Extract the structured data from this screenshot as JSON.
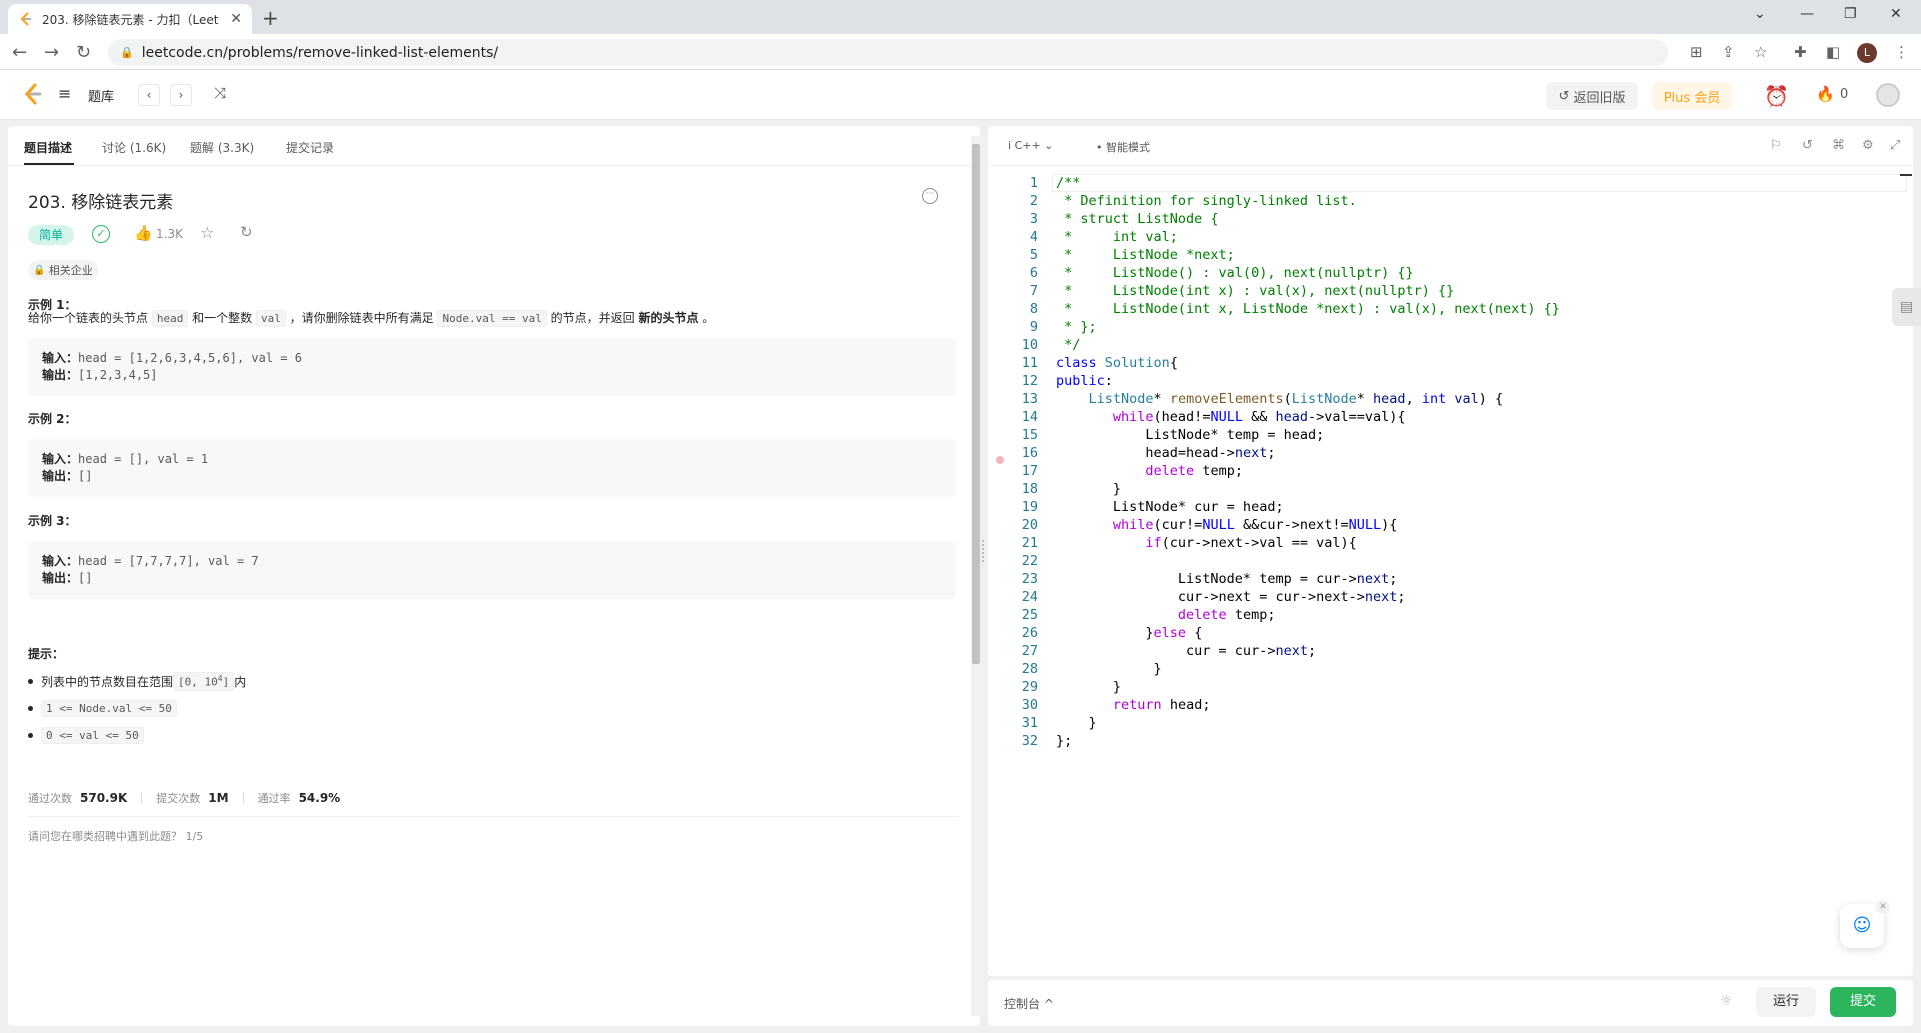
{
  "browser": {
    "tab_title": "203. 移除链表元素 - 力扣（Leet",
    "url": "leetcode.cn/problems/remove-linked-list-elements/",
    "profile_initial": "L"
  },
  "nav": {
    "problems_label": "题库",
    "old_version_label": "返回旧版",
    "plus_label": "Plus 会员",
    "fire_count": "0"
  },
  "problem": {
    "tabs": [
      "题目描述",
      "讨论 (1.6K)",
      "题解 (3.3K)",
      "提交记录"
    ],
    "title": "203. 移除链表元素",
    "difficulty": "简单",
    "likes": "1.3K",
    "company_label": "相关企业",
    "description": {
      "p1": "给你一个链表的头节点 ",
      "c1": "head",
      "p2": " 和一个整数 ",
      "c2": "val",
      "p3": " ，请你删除链表中所有满足 ",
      "c3": "Node.val == val",
      "p4": " 的节点，并返回 ",
      "bold": "新的头节点",
      "p5": " 。"
    },
    "examples": [
      {
        "heading": "示例 1：",
        "input_label": "输入：",
        "input": "head = [1,2,6,3,4,5,6], val = 6",
        "output_label": "输出：",
        "output": "[1,2,3,4,5]"
      },
      {
        "heading": "示例 2：",
        "input_label": "输入：",
        "input": "head = [], val = 1",
        "output_label": "输出：",
        "output": "[]"
      },
      {
        "heading": "示例 3：",
        "input_label": "输入：",
        "input": "head = [7,7,7,7], val = 7",
        "output_label": "输出：",
        "output": "[]"
      }
    ],
    "hints_heading": "提示：",
    "hint1_text": "列表中的节点数目在范围 ",
    "hint1_code": "[0, 10",
    "hint1_sup": "4",
    "hint1_code_end": "]",
    "hint1_suffix": " 内",
    "hint2": "1 <= Node.val <= 50",
    "hint3": "0 <= val <= 50",
    "stats": {
      "accepted_label": "通过次数",
      "accepted": "570.9K",
      "submissions_label": "提交次数",
      "submissions": "1M",
      "rate_label": "通过率",
      "rate": "54.9%"
    },
    "survey": "请问您在哪类招聘中遇到此题？    1/5"
  },
  "editor": {
    "language": "C++",
    "mode": "智能模式",
    "lines": [
      [
        [
          "cm",
          "/**"
        ]
      ],
      [
        [
          "cm",
          " * Definition for singly-linked list."
        ]
      ],
      [
        [
          "cm",
          " * struct ListNode {"
        ]
      ],
      [
        [
          "cm",
          " *     int val;"
        ]
      ],
      [
        [
          "cm",
          " *     ListNode *next;"
        ]
      ],
      [
        [
          "cm",
          " *     ListNode() : val(0), next(nullptr) {}"
        ]
      ],
      [
        [
          "cm",
          " *     ListNode(int x) : val(x), next(nullptr) {}"
        ]
      ],
      [
        [
          "cm",
          " *     ListNode(int x, ListNode *next) : val(x), next(next) {}"
        ]
      ],
      [
        [
          "cm",
          " * };"
        ]
      ],
      [
        [
          "cm",
          " */"
        ]
      ],
      [
        [
          "kw",
          "class "
        ],
        [
          "ty",
          "Solution"
        ],
        [
          "",
          "{"
        ]
      ],
      [
        [
          "kw",
          "public"
        ],
        [
          "",
          ":"
        ]
      ],
      [
        [
          "",
          "    "
        ],
        [
          "ty",
          "ListNode"
        ],
        [
          "",
          "* "
        ],
        [
          "fn",
          "removeElements"
        ],
        [
          "",
          "("
        ],
        [
          "ty",
          "ListNode"
        ],
        [
          "",
          "* "
        ],
        [
          "vr",
          "head"
        ],
        [
          "",
          ", "
        ],
        [
          "kw",
          "int "
        ],
        [
          "vr",
          "val"
        ],
        [
          "",
          ") {"
        ]
      ],
      [
        [
          "",
          "       "
        ],
        [
          "pu",
          "while"
        ],
        [
          "",
          "(head!="
        ],
        [
          "kw",
          "NULL"
        ],
        [
          "",
          " && "
        ],
        [
          "vr",
          "head"
        ],
        [
          "",
          "->val==val){"
        ]
      ],
      [
        [
          "",
          "           ListNode* temp = head;"
        ]
      ],
      [
        [
          "",
          "           head=head->"
        ],
        [
          "vr",
          "next"
        ],
        [
          "",
          ";"
        ]
      ],
      [
        [
          "",
          "           "
        ],
        [
          "pu",
          "delete"
        ],
        [
          "",
          " temp;"
        ]
      ],
      [
        [
          "",
          "       }"
        ]
      ],
      [
        [
          "",
          "       ListNode* cur = head;"
        ]
      ],
      [
        [
          "",
          "       "
        ],
        [
          "pu",
          "while"
        ],
        [
          "",
          "(cur!="
        ],
        [
          "kw",
          "NULL"
        ],
        [
          "",
          " &&cur->next!="
        ],
        [
          "kw",
          "NULL"
        ],
        [
          "",
          "){"
        ]
      ],
      [
        [
          "",
          "           "
        ],
        [
          "pu",
          "if"
        ],
        [
          "",
          "(cur->next->val == val){"
        ]
      ],
      [
        [
          "",
          " "
        ]
      ],
      [
        [
          "",
          "               ListNode* temp = cur->"
        ],
        [
          "vr",
          "next"
        ],
        [
          "",
          ";"
        ]
      ],
      [
        [
          "",
          "               cur->next = cur->next->"
        ],
        [
          "vr",
          "next"
        ],
        [
          "",
          ";"
        ]
      ],
      [
        [
          "",
          "               "
        ],
        [
          "pu",
          "delete"
        ],
        [
          "",
          " temp;"
        ]
      ],
      [
        [
          "",
          "           }"
        ],
        [
          "pu",
          "else"
        ],
        [
          "",
          " {"
        ]
      ],
      [
        [
          "",
          "                cur = cur->"
        ],
        [
          "vr",
          "next"
        ],
        [
          "",
          ";"
        ]
      ],
      [
        [
          "",
          "            }"
        ]
      ],
      [
        [
          "",
          "       }"
        ]
      ],
      [
        [
          "",
          "       "
        ],
        [
          "pu",
          "return"
        ],
        [
          "",
          " head;"
        ]
      ],
      [
        [
          "",
          "    }"
        ]
      ],
      [
        [
          "",
          "};"
        ]
      ]
    ]
  },
  "bottom": {
    "console_label": "控制台 ^",
    "run_label": "运行",
    "submit_label": "提交"
  }
}
